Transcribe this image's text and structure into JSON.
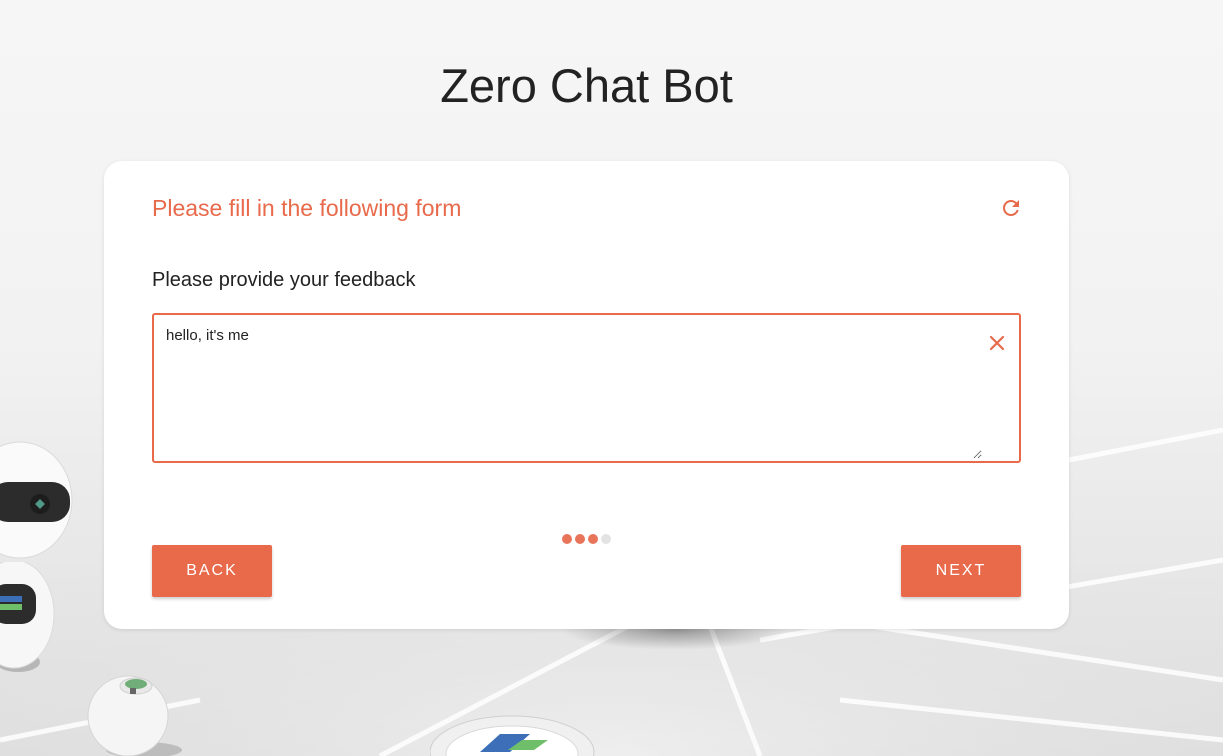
{
  "page": {
    "title": "Zero Chat Bot"
  },
  "form": {
    "heading": "Please fill in the following form",
    "question": "Please provide your feedback",
    "feedback_value": "hello, it's me",
    "back_label": "BACK",
    "next_label": "NEXT",
    "progress": {
      "completed": 3,
      "total": 4
    }
  },
  "icons": {
    "refresh": "refresh-icon",
    "clear": "close-icon"
  },
  "colors": {
    "accent": "#e86a4b",
    "title": "#222222",
    "progress_inactive": "#e3e3e3"
  }
}
